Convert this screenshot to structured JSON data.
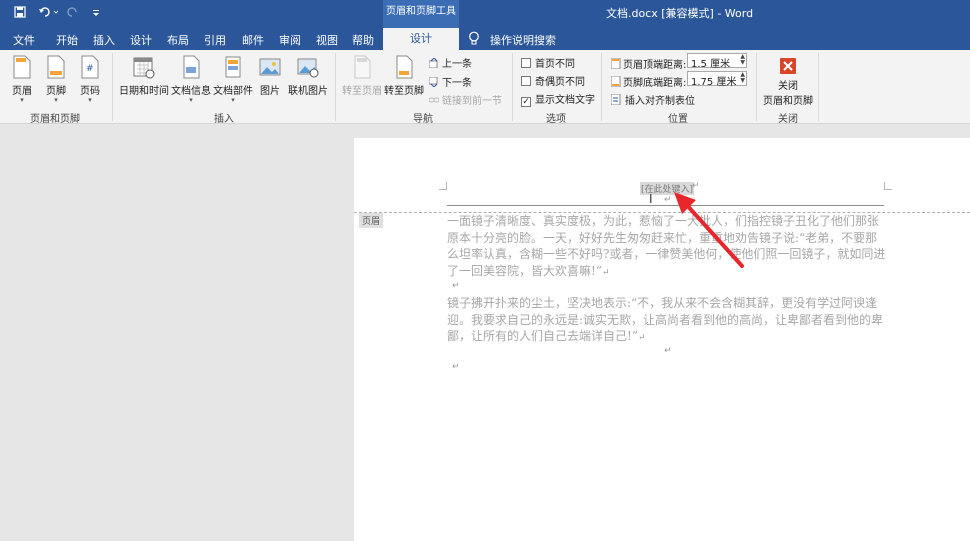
{
  "titlebar": {
    "context_tab": "页眉和页脚工具",
    "document_title": "文档.docx [兼容模式] - Word"
  },
  "tabs": {
    "file": "文件",
    "home": "开始",
    "insert": "插入",
    "design": "设计",
    "layout": "布局",
    "references": "引用",
    "mailings": "邮件",
    "review": "审阅",
    "view": "视图",
    "help": "帮助",
    "active_design": "设计",
    "tell_me": "操作说明搜索"
  },
  "ribbon": {
    "header_footer": {
      "header": "页眉",
      "footer": "页脚",
      "page_number": "页码",
      "group_label": "页眉和页脚"
    },
    "insert": {
      "date_time": "日期和时间",
      "doc_info": "文档信息",
      "quick_parts": "文档部件",
      "pictures": "图片",
      "online_pictures": "联机图片",
      "group_label": "插入"
    },
    "navigation": {
      "go_to_header": "转至页眉",
      "go_to_footer": "转至页脚",
      "previous": "上一条",
      "next": "下一条",
      "link_to_previous": "链接到前一节",
      "group_label": "导航"
    },
    "options": {
      "different_first_page": "首页不同",
      "different_odd_even": "奇偶页不同",
      "show_document_text": "显示文档文字",
      "show_document_text_checked": true,
      "group_label": "选项"
    },
    "position": {
      "header_from_top_label": "页眉顶端距离:",
      "header_from_top_value": "1.5 厘米",
      "footer_from_bottom_label": "页脚底端距离:",
      "footer_from_bottom_value": "1.75 厘米",
      "insert_alignment_tab": "插入对齐制表位",
      "group_label": "位置"
    },
    "close": {
      "close_line1": "关闭",
      "close_line2": "页眉和页脚",
      "group_label": "关闭"
    }
  },
  "document": {
    "header_tag": "页眉",
    "header_placeholder": "[在此处键入]",
    "paragraph1": "一面镜子清晰度、真实度极，为此，惹恼了一大批人，们指控镜子丑化了他们那张原本十分亮的脸。一天，好好先生匆匆赶来忙，重重地劝告镜子说:“老弟，不要那么坦率认真，含糊一些不好吗?或者，一律赞美他何，使他们照一回镜子，就如同进了一回美容院，皆大欢喜嘛!”",
    "paragraph2": "镜子拂开扑来的尘土，坚决地表示:“不，我从来不会含糊其辞，更没有学过阿谀逢迎。我要求自己的永远是:诚实无欺，让高尚者看到他的高尚，让卑鄙者看到他的卑鄙，让所有的人们自己去端详自己!”",
    "return_mark": "↵"
  },
  "colors": {
    "ribbon_blue": "#2b579a",
    "annotation_arrow": "#e8262b"
  }
}
